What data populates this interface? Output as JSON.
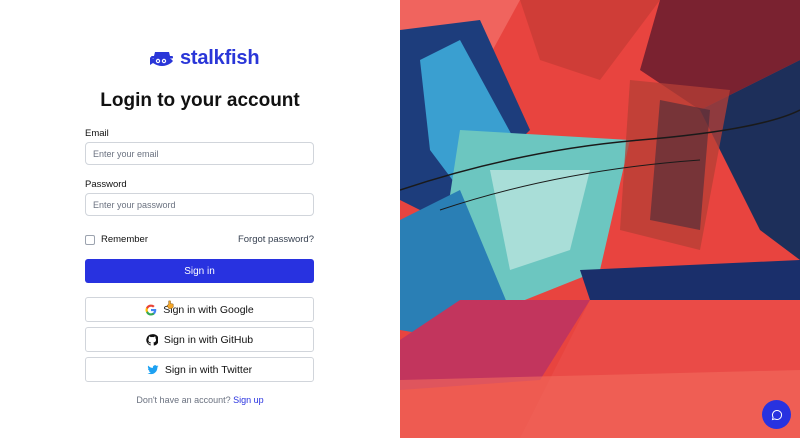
{
  "brand": {
    "name": "stalkfish",
    "logo": "hat-fish-logo"
  },
  "title": "Login to your account",
  "email": {
    "label": "Email",
    "placeholder": "Enter your email",
    "value": ""
  },
  "password": {
    "label": "Password",
    "placeholder": "Enter your password",
    "value": ""
  },
  "remember": {
    "label": "Remember",
    "checked": false
  },
  "forgot": "Forgot password?",
  "sign_in": "Sign in",
  "social": [
    {
      "label": "Sign in with Google",
      "icon": "google-icon"
    },
    {
      "label": "Sign in with GitHub",
      "icon": "github-icon"
    },
    {
      "label": "Sign in with Twitter",
      "icon": "twitter-icon"
    }
  ],
  "signup": {
    "prompt": "Don't have an account?",
    "link": "Sign up"
  },
  "colors": {
    "primary": "#2832e0",
    "brand": "#2a36d8"
  },
  "chat_button": {
    "icon": "chat-bubble-icon"
  }
}
